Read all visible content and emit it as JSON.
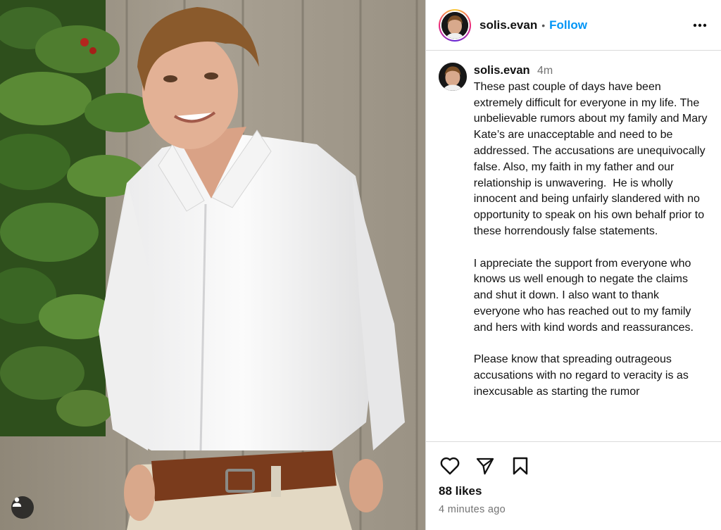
{
  "post": {
    "username": "solis.evan",
    "follow_label": "Follow",
    "separator": "•",
    "more_icon": "more-horizontal-icon"
  },
  "caption": {
    "username": "solis.evan",
    "time": "4m",
    "paragraphs": [
      "These past couple of days have been extremely difficult for everyone in my life. The unbelievable rumors about my family and Mary Kate’s are unacceptable and need to be addressed. The accusations are unequivocally false. Also, my faith in my father and our relationship is unwavering.  He is wholly innocent and being unfairly slandered with no opportunity to speak on his own behalf prior to these horrendously false statements.",
      "I appreciate the support from everyone who knows us well enough to negate the claims and shut it down. I also want to thank everyone who has reached out to my family and hers with kind words and reassurances.",
      "Please know that spreading outrageous accusations with no regard to veracity is as inexcusable as starting the rumor"
    ]
  },
  "actions": {
    "like_icon": "heart-icon",
    "share_icon": "paper-plane-icon",
    "save_icon": "bookmark-icon",
    "likes": "88 likes",
    "posted": "4 minutes ago"
  },
  "photo": {
    "tag_icon": "user-tag-icon"
  },
  "colors": {
    "accent": "#0095f6",
    "muted": "#737373",
    "border": "#dbdbdb"
  }
}
